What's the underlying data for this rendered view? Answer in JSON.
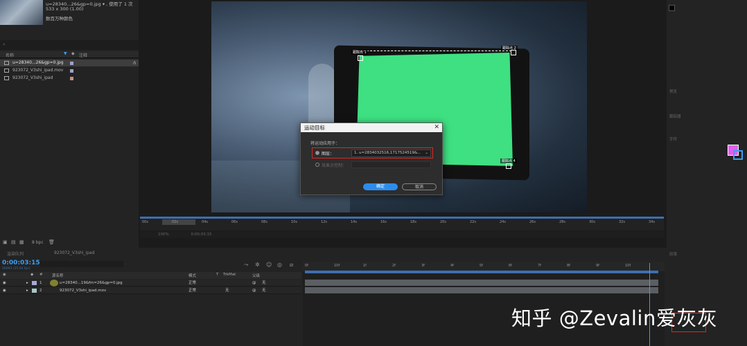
{
  "project": {
    "item_name": "u=28340...26&gp=0.jpg",
    "item_info": "533 x 300 (1.00)",
    "used_count": "使用了 1 次",
    "color_label": "数百万种颜色",
    "col_name": "名称",
    "col_comment": "注释",
    "items": [
      {
        "name": "u=28340...26&gp=0.jpg",
        "color": "#9fa0c8"
      },
      {
        "name": "923072_V3shi_ipad.mov",
        "color": "#9fa0c8"
      },
      {
        "name": "923072_V3shi_ipad",
        "color": "#c78f80"
      }
    ],
    "bpc": "8 bpc"
  },
  "viewer": {
    "corner_top_left": "跟踪点 1",
    "corner_top_right": "跟踪点 2",
    "corner_bottom_right": "跟踪点 4",
    "zoom": "100%",
    "timecode": "0:00:03:15"
  },
  "ruler_ticks": [
    "00s",
    "02s",
    "04s",
    "06s",
    "08s",
    "10s",
    "12s",
    "14s",
    "16s",
    "18s",
    "20s",
    "22s",
    "24s",
    "26s",
    "28s",
    "30s",
    "32s",
    "34s"
  ],
  "dialog": {
    "title": "运动目标",
    "apply_label": "将运动应用于：",
    "layer_option": "图层：",
    "layer_value": "1. u=2834032516,1717524519&...",
    "effect_option": "效果点控制：",
    "ok": "确定",
    "cancel": "取消"
  },
  "timeline": {
    "tab1": "渲染队列",
    "tab2": "923072_V3shi_ipad",
    "timecode": "0:00:03:15",
    "frame_info": "00093 (25.00 fps)",
    "col_source": "源名称",
    "col_mode": "模式",
    "col_t": "T",
    "col_trkmat": "TrkMat",
    "col_parent": "父级",
    "ticks": [
      "0f",
      "10f",
      "1f",
      "2f",
      "3f",
      "4f",
      "5f",
      "6f",
      "7f",
      "8f",
      "9f",
      "10f"
    ],
    "layers": [
      {
        "num": "1",
        "name": "u=28340...19&fm=26&gp=0.jpg",
        "mode": "正常",
        "trkmat": "",
        "parent": "无",
        "color": "#a8a8d8"
      },
      {
        "num": "2",
        "name": "923072_V3shi_ipad.mov",
        "mode": "正常",
        "trkmat": "无",
        "parent": "无",
        "color": "#a8c8c8"
      }
    ]
  },
  "right_panel": {
    "info_label": "信息",
    "preview_label": "预览",
    "tracker_label": "跟踪器",
    "paragraph_label": "段落",
    "char_label": "字符",
    "accent_color": "#e060f0"
  },
  "watermark": "知乎 @Zevalin爱灰灰"
}
